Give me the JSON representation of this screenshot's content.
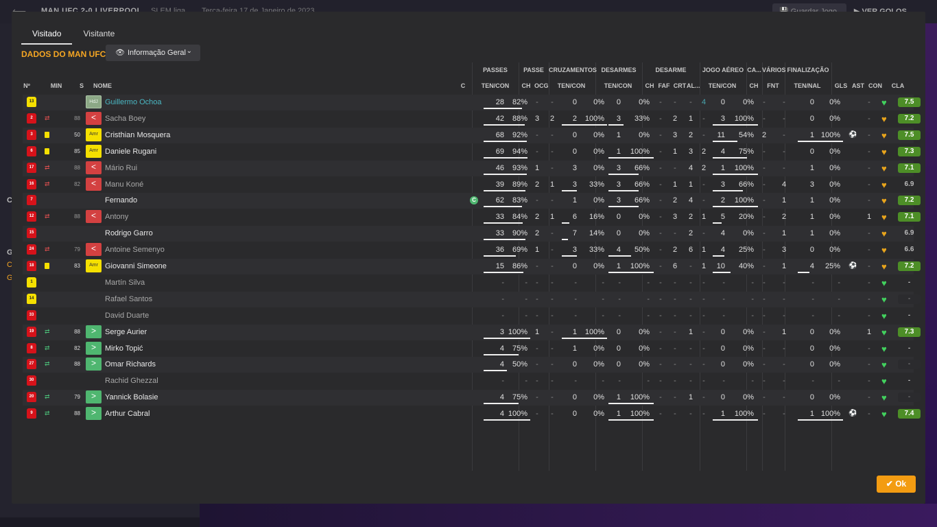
{
  "app": {
    "match_title": "MAN UFC 2-0 LIVERPOOL",
    "league": "SLEM liga",
    "date": "Terça-feira 17 de Janeiro de 2023",
    "save_label": "Guardar Jogo",
    "goals_label": "VER GOLOS",
    "left_letters": [
      "C",
      "G",
      "C",
      "G"
    ]
  },
  "tabs": [
    "Visitado",
    "Visitante"
  ],
  "section_title": "DADOS DO MAN UFC",
  "view_button": "Informação Geral",
  "ok_label": "Ok",
  "groups": [
    "PASSES",
    "PASSE",
    "CRUZAMENTOS",
    "DESARMES",
    "DESARME",
    "JOGO AÉREO",
    "CA...",
    "VÁRIOS",
    "FINALIZAÇÃO"
  ],
  "headers": [
    "Nº",
    "MIN",
    "S",
    "NOME",
    "C",
    "TEN/CON",
    "CH",
    "OCG",
    "TEN/CON",
    "TEN/CON",
    "CH",
    "FAF",
    "CRT",
    "AL...",
    "TEN/CON",
    "CH",
    "FNT",
    "TEN/NAL",
    "GLS",
    "AST",
    "CON",
    "CLA"
  ],
  "players": [
    {
      "num": "13",
      "gk": true,
      "sub": "",
      "card": false,
      "min": "",
      "pos": "HdJ",
      "posType": "gk",
      "name": "Guillermo Ochoa",
      "nameStyle": "link",
      "cap": false,
      "pt": "28",
      "pc": "82%",
      "pch": "-",
      "ocg": "-",
      "ct": "0",
      "cc": "0%",
      "dt": "0",
      "dc": "0%",
      "dch": "-",
      "faf": "-",
      "crt": "-",
      "al": "4",
      "at": "0",
      "ac": "0%",
      "ca": "-",
      "fnt": "-",
      "ft": "0",
      "fc": "0%",
      "gls": "",
      "ast": "-",
      "con": "green",
      "cla": "7.5",
      "claStyle": "green",
      "pb": 0.82,
      "cb": 0,
      "db": 0,
      "ab": 0,
      "fb": 0,
      "ball": false
    },
    {
      "num": "2",
      "gk": false,
      "sub": "out",
      "card": false,
      "min": "88",
      "pos": "<",
      "posType": "out",
      "name": "Sacha Boey",
      "nameStyle": "dim",
      "cap": false,
      "pt": "42",
      "pc": "88%",
      "pch": "3",
      "ocg": "2",
      "ct": "2",
      "cc": "100%",
      "dt": "3",
      "dc": "33%",
      "dch": "-",
      "faf": "2",
      "crt": "1",
      "al": "-",
      "at": "3",
      "ac": "100%",
      "ca": "-",
      "fnt": "-",
      "ft": "0",
      "fc": "0%",
      "gls": "",
      "ast": "-",
      "con": "gold",
      "cla": "7.2",
      "claStyle": "green",
      "pb": 0.88,
      "cb": 1,
      "db": 0.33,
      "ab": 1,
      "fb": 0,
      "ball": false
    },
    {
      "num": "3",
      "gk": false,
      "sub": "",
      "card": true,
      "min": "50",
      "pos": "Amr",
      "posType": "amr",
      "name": "Cristhian Mosquera",
      "nameStyle": "",
      "cap": false,
      "pt": "68",
      "pc": "92%",
      "pch": "-",
      "ocg": "-",
      "ct": "0",
      "cc": "0%",
      "dt": "1",
      "dc": "0%",
      "dch": "-",
      "faf": "3",
      "crt": "2",
      "al": "-",
      "at": "11",
      "ac": "54%",
      "ca": "2",
      "fnt": "-",
      "ft": "1",
      "fc": "100%",
      "gls": "ball",
      "ast": "-",
      "con": "gold",
      "cla": "7.5",
      "claStyle": "green",
      "pb": 0.92,
      "cb": 0,
      "db": 0,
      "ab": 0.54,
      "fb": 1,
      "ball": true
    },
    {
      "num": "6",
      "gk": false,
      "sub": "",
      "card": true,
      "min": "85",
      "pos": "Amr",
      "posType": "amr",
      "name": "Daniele Rugani",
      "nameStyle": "",
      "cap": false,
      "pt": "69",
      "pc": "94%",
      "pch": "-",
      "ocg": "-",
      "ct": "0",
      "cc": "0%",
      "dt": "1",
      "dc": "100%",
      "dch": "-",
      "faf": "1",
      "crt": "3",
      "al": "2",
      "at": "4",
      "ac": "75%",
      "ca": "-",
      "fnt": "-",
      "ft": "0",
      "fc": "0%",
      "gls": "",
      "ast": "-",
      "con": "gold",
      "cla": "7.3",
      "claStyle": "green",
      "pb": 0.94,
      "cb": 0,
      "db": 1,
      "ab": 0.75,
      "fb": 0,
      "ball": false
    },
    {
      "num": "17",
      "gk": false,
      "sub": "out",
      "card": false,
      "min": "88",
      "pos": "<",
      "posType": "out",
      "name": "Mário Rui",
      "nameStyle": "dim",
      "cap": false,
      "pt": "46",
      "pc": "93%",
      "pch": "1",
      "ocg": "-",
      "ct": "3",
      "cc": "0%",
      "dt": "3",
      "dc": "66%",
      "dch": "-",
      "faf": "-",
      "crt": "4",
      "al": "2",
      "at": "1",
      "ac": "100%",
      "ca": "-",
      "fnt": "-",
      "ft": "1",
      "fc": "0%",
      "gls": "",
      "ast": "-",
      "con": "gold",
      "cla": "7.1",
      "claStyle": "green",
      "pb": 0.93,
      "cb": 0,
      "db": 0.66,
      "ab": 1,
      "fb": 0,
      "ball": false
    },
    {
      "num": "16",
      "gk": false,
      "sub": "out",
      "card": false,
      "min": "82",
      "pos": "<",
      "posType": "out",
      "name": "Manu Koné",
      "nameStyle": "dim",
      "cap": false,
      "pt": "39",
      "pc": "89%",
      "pch": "2",
      "ocg": "1",
      "ct": "3",
      "cc": "33%",
      "dt": "3",
      "dc": "66%",
      "dch": "-",
      "faf": "1",
      "crt": "1",
      "al": "-",
      "at": "3",
      "ac": "66%",
      "ca": "-",
      "fnt": "4",
      "ft": "3",
      "fc": "0%",
      "gls": "",
      "ast": "-",
      "con": "gold",
      "cla": "6.9",
      "claStyle": "plain",
      "pb": 0.89,
      "cb": 0.33,
      "db": 0.66,
      "ab": 0.66,
      "fb": 0,
      "ball": false
    },
    {
      "num": "7",
      "gk": false,
      "sub": "",
      "card": false,
      "min": "",
      "pos": "",
      "posType": "",
      "name": "Fernando",
      "nameStyle": "",
      "cap": true,
      "pt": "62",
      "pc": "83%",
      "pch": "-",
      "ocg": "-",
      "ct": "1",
      "cc": "0%",
      "dt": "3",
      "dc": "66%",
      "dch": "-",
      "faf": "2",
      "crt": "4",
      "al": "-",
      "at": "2",
      "ac": "100%",
      "ca": "-",
      "fnt": "1",
      "ft": "1",
      "fc": "0%",
      "gls": "",
      "ast": "-",
      "con": "gold",
      "cla": "7.2",
      "claStyle": "green",
      "pb": 0.83,
      "cb": 0,
      "db": 0.66,
      "ab": 1,
      "fb": 0,
      "ball": false
    },
    {
      "num": "12",
      "gk": false,
      "sub": "out",
      "card": false,
      "min": "88",
      "pos": "<",
      "posType": "out",
      "name": "Antony",
      "nameStyle": "dim",
      "cap": false,
      "pt": "33",
      "pc": "84%",
      "pch": "2",
      "ocg": "1",
      "ct": "6",
      "cc": "16%",
      "dt": "0",
      "dc": "0%",
      "dch": "-",
      "faf": "3",
      "crt": "2",
      "al": "1",
      "at": "5",
      "ac": "20%",
      "ca": "-",
      "fnt": "2",
      "ft": "1",
      "fc": "0%",
      "gls": "",
      "ast": "1",
      "con": "gold",
      "cla": "7.1",
      "claStyle": "green",
      "pb": 0.84,
      "cb": 0.16,
      "db": 0,
      "ab": 0.2,
      "fb": 0,
      "ball": false
    },
    {
      "num": "15",
      "gk": false,
      "sub": "",
      "card": false,
      "min": "",
      "pos": "",
      "posType": "",
      "name": "Rodrigo Garro",
      "nameStyle": "",
      "cap": false,
      "pt": "33",
      "pc": "90%",
      "pch": "2",
      "ocg": "-",
      "ct": "7",
      "cc": "14%",
      "dt": "0",
      "dc": "0%",
      "dch": "-",
      "faf": "-",
      "crt": "2",
      "al": "-",
      "at": "4",
      "ac": "0%",
      "ca": "-",
      "fnt": "1",
      "ft": "1",
      "fc": "0%",
      "gls": "",
      "ast": "-",
      "con": "gold",
      "cla": "6.9",
      "claStyle": "plain",
      "pb": 0.9,
      "cb": 0.14,
      "db": 0,
      "ab": 0,
      "fb": 0,
      "ball": false
    },
    {
      "num": "24",
      "gk": false,
      "sub": "out",
      "card": false,
      "min": "79",
      "pos": "<",
      "posType": "out",
      "name": "Antoine Semenyo",
      "nameStyle": "dim",
      "cap": false,
      "pt": "36",
      "pc": "69%",
      "pch": "1",
      "ocg": "-",
      "ct": "3",
      "cc": "33%",
      "dt": "4",
      "dc": "50%",
      "dch": "-",
      "faf": "2",
      "crt": "6",
      "al": "1",
      "at": "4",
      "ac": "25%",
      "ca": "-",
      "fnt": "3",
      "ft": "0",
      "fc": "0%",
      "gls": "",
      "ast": "-",
      "con": "gold",
      "cla": "6.6",
      "claStyle": "plain",
      "pb": 0.69,
      "cb": 0.33,
      "db": 0.5,
      "ab": 0.25,
      "fb": 0,
      "ball": false
    },
    {
      "num": "18",
      "gk": false,
      "sub": "",
      "card": true,
      "min": "83",
      "pos": "Amr",
      "posType": "amr",
      "name": "Giovanni Simeone",
      "nameStyle": "",
      "cap": false,
      "pt": "15",
      "pc": "86%",
      "pch": "-",
      "ocg": "-",
      "ct": "0",
      "cc": "0%",
      "dt": "1",
      "dc": "100%",
      "dch": "-",
      "faf": "6",
      "crt": "-",
      "al": "1",
      "at": "10",
      "ac": "40%",
      "ca": "-",
      "fnt": "1",
      "ft": "4",
      "fc": "25%",
      "gls": "ball",
      "ast": "-",
      "con": "gold",
      "cla": "7.2",
      "claStyle": "green",
      "pb": 0.86,
      "cb": 0,
      "db": 1,
      "ab": 0.4,
      "fb": 0.25,
      "ball": true
    },
    {
      "num": "1",
      "gk": true,
      "sub": "",
      "card": false,
      "min": "",
      "pos": "",
      "posType": "",
      "name": "Martín Silva",
      "nameStyle": "dim",
      "cap": false,
      "pt": "-",
      "pc": "-",
      "pch": "-",
      "ocg": "-",
      "ct": "-",
      "cc": "-",
      "dt": "-",
      "dc": "-",
      "dch": "-",
      "faf": "-",
      "crt": "-",
      "al": "-",
      "at": "-",
      "ac": "-",
      "ca": "-",
      "fnt": "-",
      "ft": "-",
      "fc": "-",
      "gls": "",
      "ast": "-",
      "con": "green",
      "cla": "-",
      "claStyle": "plain",
      "pb": 0,
      "cb": 0,
      "db": 0,
      "ab": 0,
      "fb": 0,
      "ball": false
    },
    {
      "num": "14",
      "gk": true,
      "sub": "",
      "card": false,
      "min": "",
      "pos": "",
      "posType": "",
      "name": "Rafael Santos",
      "nameStyle": "dim",
      "cap": false,
      "pt": "-",
      "pc": "-",
      "pch": "-",
      "ocg": "-",
      "ct": "-",
      "cc": "-",
      "dt": "-",
      "dc": "-",
      "dch": "-",
      "faf": "-",
      "crt": "-",
      "al": "-",
      "at": "-",
      "ac": "-",
      "ca": "-",
      "fnt": "-",
      "ft": "-",
      "fc": "-",
      "gls": "",
      "ast": "-",
      "con": "green",
      "cla": "-",
      "claStyle": "box",
      "pb": 0,
      "cb": 0,
      "db": 0,
      "ab": 0,
      "fb": 0,
      "ball": false
    },
    {
      "num": "33",
      "gk": false,
      "sub": "",
      "card": false,
      "min": "",
      "pos": "",
      "posType": "",
      "name": "David Duarte",
      "nameStyle": "dim",
      "cap": false,
      "pt": "-",
      "pc": "-",
      "pch": "-",
      "ocg": "-",
      "ct": "-",
      "cc": "-",
      "dt": "-",
      "dc": "-",
      "dch": "-",
      "faf": "-",
      "crt": "-",
      "al": "-",
      "at": "-",
      "ac": "-",
      "ca": "-",
      "fnt": "-",
      "ft": "-",
      "fc": "-",
      "gls": "",
      "ast": "-",
      "con": "green",
      "cla": "-",
      "claStyle": "plain",
      "pb": 0,
      "cb": 0,
      "db": 0,
      "ab": 0,
      "fb": 0,
      "ball": false
    },
    {
      "num": "19",
      "gk": false,
      "sub": "in",
      "card": false,
      "min": "88",
      "pos": ">",
      "posType": "inn",
      "name": "Serge Aurier",
      "nameStyle": "",
      "cap": false,
      "pt": "3",
      "pc": "100%",
      "pch": "1",
      "ocg": "-",
      "ct": "1",
      "cc": "100%",
      "dt": "0",
      "dc": "0%",
      "dch": "-",
      "faf": "-",
      "crt": "1",
      "al": "-",
      "at": "0",
      "ac": "0%",
      "ca": "-",
      "fnt": "1",
      "ft": "0",
      "fc": "0%",
      "gls": "",
      "ast": "1",
      "con": "green",
      "cla": "7.3",
      "claStyle": "green",
      "pb": 1,
      "cb": 1,
      "db": 0,
      "ab": 0,
      "fb": 0,
      "ball": false
    },
    {
      "num": "8",
      "gk": false,
      "sub": "in",
      "card": false,
      "min": "82",
      "pos": ">",
      "posType": "inn",
      "name": "Mirko Topić",
      "nameStyle": "",
      "cap": false,
      "pt": "4",
      "pc": "75%",
      "pch": "-",
      "ocg": "-",
      "ct": "1",
      "cc": "0%",
      "dt": "0",
      "dc": "0%",
      "dch": "-",
      "faf": "-",
      "crt": "-",
      "al": "-",
      "at": "0",
      "ac": "0%",
      "ca": "-",
      "fnt": "-",
      "ft": "0",
      "fc": "0%",
      "gls": "",
      "ast": "-",
      "con": "green",
      "cla": "-",
      "claStyle": "plain",
      "pb": 0.75,
      "cb": 0,
      "db": 0,
      "ab": 0,
      "fb": 0,
      "ball": false
    },
    {
      "num": "27",
      "gk": false,
      "sub": "in",
      "card": false,
      "min": "88",
      "pos": ">",
      "posType": "inn",
      "name": "Omar Richards",
      "nameStyle": "",
      "cap": false,
      "pt": "4",
      "pc": "50%",
      "pch": "-",
      "ocg": "-",
      "ct": "0",
      "cc": "0%",
      "dt": "0",
      "dc": "0%",
      "dch": "-",
      "faf": "-",
      "crt": "-",
      "al": "-",
      "at": "0",
      "ac": "0%",
      "ca": "-",
      "fnt": "-",
      "ft": "0",
      "fc": "0%",
      "gls": "",
      "ast": "-",
      "con": "green",
      "cla": "-",
      "claStyle": "box",
      "pb": 0.5,
      "cb": 0,
      "db": 0,
      "ab": 0,
      "fb": 0,
      "ball": false
    },
    {
      "num": "30",
      "gk": false,
      "sub": "",
      "card": false,
      "min": "",
      "pos": "",
      "posType": "",
      "name": "Rachid Ghezzal",
      "nameStyle": "dim",
      "cap": false,
      "pt": "-",
      "pc": "-",
      "pch": "-",
      "ocg": "-",
      "ct": "-",
      "cc": "-",
      "dt": "-",
      "dc": "-",
      "dch": "-",
      "faf": "-",
      "crt": "-",
      "al": "-",
      "at": "-",
      "ac": "-",
      "ca": "-",
      "fnt": "-",
      "ft": "-",
      "fc": "-",
      "gls": "",
      "ast": "-",
      "con": "green",
      "cla": "-",
      "claStyle": "plain",
      "pb": 0,
      "cb": 0,
      "db": 0,
      "ab": 0,
      "fb": 0,
      "ball": false
    },
    {
      "num": "20",
      "gk": false,
      "sub": "in",
      "card": false,
      "min": "79",
      "pos": ">",
      "posType": "inn",
      "name": "Yannick Bolasie",
      "nameStyle": "",
      "cap": false,
      "pt": "4",
      "pc": "75%",
      "pch": "-",
      "ocg": "-",
      "ct": "0",
      "cc": "0%",
      "dt": "1",
      "dc": "100%",
      "dch": "-",
      "faf": "-",
      "crt": "1",
      "al": "-",
      "at": "0",
      "ac": "0%",
      "ca": "-",
      "fnt": "-",
      "ft": "0",
      "fc": "0%",
      "gls": "",
      "ast": "-",
      "con": "green",
      "cla": "-",
      "claStyle": "box",
      "pb": 0.75,
      "cb": 0,
      "db": 1,
      "ab": 0,
      "fb": 0,
      "ball": false
    },
    {
      "num": "9",
      "gk": false,
      "sub": "in",
      "card": false,
      "min": "88",
      "pos": ">",
      "posType": "inn",
      "name": "Arthur Cabral",
      "nameStyle": "",
      "cap": false,
      "pt": "4",
      "pc": "100%",
      "pch": "-",
      "ocg": "-",
      "ct": "0",
      "cc": "0%",
      "dt": "1",
      "dc": "100%",
      "dch": "-",
      "faf": "-",
      "crt": "-",
      "al": "-",
      "at": "1",
      "ac": "100%",
      "ca": "-",
      "fnt": "-",
      "ft": "1",
      "fc": "100%",
      "gls": "ball",
      "ast": "-",
      "con": "green",
      "cla": "7.4",
      "claStyle": "green",
      "pb": 1,
      "cb": 0,
      "db": 1,
      "ab": 1,
      "fb": 1,
      "ball": true
    }
  ],
  "colors": {
    "accent": "#f5a623",
    "ok": "#f39c12",
    "rating": "#4d8e27",
    "red": "#d6121a",
    "green": "#4fb670"
  }
}
